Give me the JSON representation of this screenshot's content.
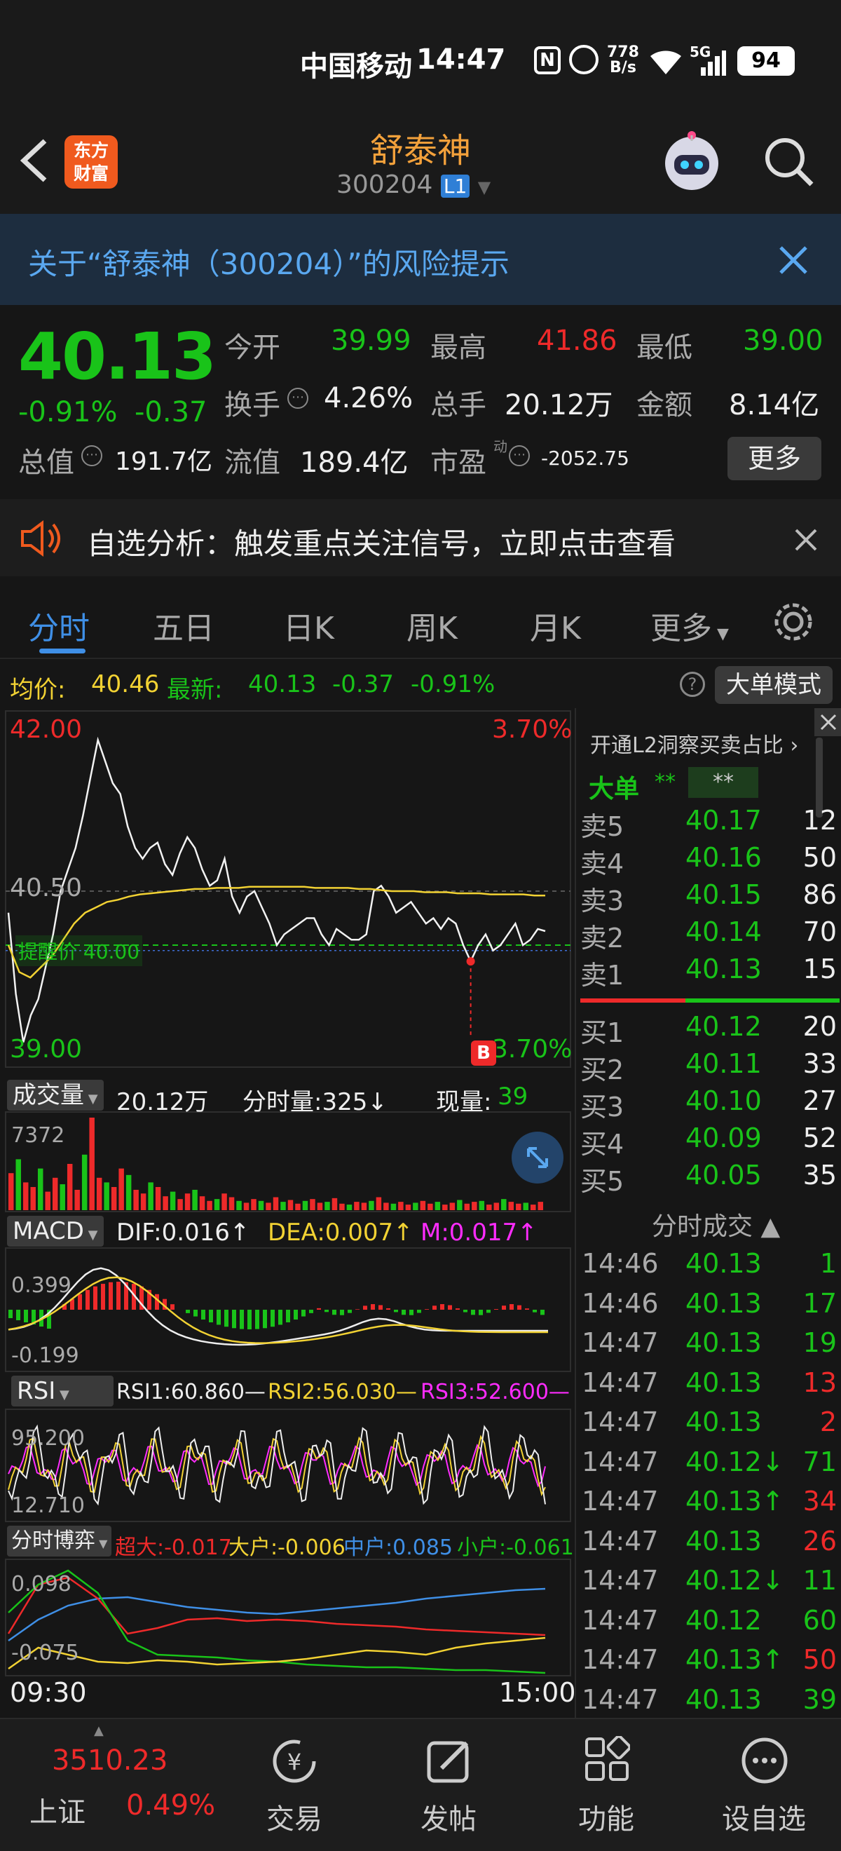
{
  "status_bar": {
    "carrier": "中国移动",
    "time": "14:47",
    "net_speed_value": "778",
    "net_speed_unit": "B/s",
    "signal": "5G",
    "battery": "94"
  },
  "header": {
    "brand": "东方财富",
    "brand_line1": "东方",
    "brand_line2": "财富",
    "title": "舒泰神",
    "code": "300204",
    "level": "L1"
  },
  "risk_banner": {
    "text": "关于“舒泰神（300204）”的风险提示"
  },
  "quote": {
    "price": "40.13",
    "change_pct": "-0.91%",
    "change": "-0.37",
    "open_label": "今开",
    "open": "39.99",
    "high_label": "最高",
    "high": "41.86",
    "low_label": "最低",
    "low": "39.00",
    "turnover_label": "换手",
    "turnover": "4.26%",
    "volume_label": "总手",
    "volume": "20.12万",
    "amount_label": "金额",
    "amount": "8.14亿",
    "mcap_label": "总值",
    "mcap": "191.7亿",
    "float_label": "流值",
    "float": "189.4亿",
    "pe_label": "市盈",
    "pe_sup": "动",
    "pe": "-2052.75",
    "more_label": "更多"
  },
  "notice": {
    "text": "自选分析：触发重点关注信号，立即点击查看"
  },
  "tabs": [
    "分时",
    "五日",
    "日K",
    "周K",
    "月K",
    "更多"
  ],
  "avg_line": {
    "avg_label": "均价:",
    "avg_value": "40.46",
    "latest_label": "最新:",
    "latest_value": "40.13",
    "change": "-0.37",
    "change_pct": "-0.91%",
    "big_order_mode": "大单模式"
  },
  "chart_data": {
    "type": "line",
    "price_axis": {
      "top": "42.00",
      "mid": "40.50",
      "bottom": "39.00",
      "top_pct": "3.70%",
      "bottom_pct": "3.70%",
      "ylim": [
        39.0,
        42.0
      ]
    },
    "alert_price_label": "提醒价 40.00",
    "alert_price": 40.0,
    "buy_marker": "B",
    "price_series": [
      40.3,
      39.55,
      39.1,
      39.35,
      39.5,
      39.8,
      40.1,
      40.5,
      40.7,
      40.9,
      41.2,
      41.55,
      41.9,
      41.7,
      41.5,
      41.4,
      41.1,
      40.9,
      40.8,
      40.9,
      40.95,
      40.75,
      40.65,
      40.85,
      41.0,
      40.9,
      40.7,
      40.55,
      40.6,
      40.8,
      40.45,
      40.3,
      40.45,
      40.5,
      40.35,
      40.2,
      40.0,
      40.1,
      40.15,
      40.2,
      40.25,
      40.25,
      40.1,
      40.0,
      40.15,
      40.1,
      40.05,
      40.05,
      40.1,
      40.5,
      40.55,
      40.45,
      40.3,
      40.35,
      40.4,
      40.3,
      40.2,
      40.25,
      40.15,
      40.25,
      40.2,
      40.0,
      39.85,
      40.0,
      40.1,
      39.95,
      40.0,
      40.1,
      40.2,
      40.0,
      40.05,
      40.15,
      40.13
    ],
    "avg_series": [
      40.0,
      39.75,
      39.7,
      39.8,
      39.9,
      40.05,
      40.2,
      40.3,
      40.35,
      40.4,
      40.42,
      40.45,
      40.47,
      40.48,
      40.49,
      40.5,
      40.51,
      40.52,
      40.52,
      40.53,
      40.53,
      40.53,
      40.54,
      40.54,
      40.54,
      40.54,
      40.54,
      40.54,
      40.53,
      40.53,
      40.53,
      40.53,
      40.52,
      40.52,
      40.51,
      40.5,
      40.5,
      40.5,
      40.49,
      40.49,
      40.49,
      40.48,
      40.48,
      40.48,
      40.47,
      40.47,
      40.47,
      40.47,
      40.46,
      40.46
    ],
    "x_start": "09:30",
    "x_end": "15:00",
    "volume_panel": {
      "label": "成交量",
      "total": "20.12万",
      "tick_label": "分时量:325↓",
      "now_label": "现量:",
      "now_value": "39",
      "max": "7372",
      "bars": [
        40,
        55,
        30,
        25,
        45,
        20,
        35,
        28,
        50,
        22,
        60,
        100,
        35,
        30,
        25,
        45,
        38,
        22,
        18,
        30,
        25,
        15,
        20,
        12,
        18,
        22,
        15,
        10,
        12,
        18,
        14,
        10,
        8,
        12,
        10,
        8,
        14,
        9,
        11,
        7,
        10,
        12,
        8,
        9,
        13,
        7,
        6,
        9,
        8,
        10,
        14,
        8,
        7,
        9,
        6,
        8,
        10,
        7,
        9,
        6,
        8,
        11,
        7,
        9,
        10,
        6,
        8,
        12,
        9,
        7,
        8,
        6,
        9
      ]
    },
    "macd_panel": {
      "label": "MACD",
      "dif": "DIF:0.016↑",
      "dea": "DEA:0.007↑",
      "m": "M:0.017↑",
      "top": "0.399",
      "bottom": "-0.199"
    },
    "rsi_panel": {
      "label": "RSI",
      "rsi1": "RSI1:60.860—",
      "rsi2": "RSI2:56.030—",
      "rsi3": "RSI3:52.600—",
      "top": "95.200",
      "bottom": "12.710"
    },
    "flow_panel": {
      "label": "分时博弈",
      "super": "超大:-0.017",
      "big": "大户:-0.006",
      "mid": "中户:0.085",
      "small": "小户:-0.061",
      "top": "0.098",
      "bottom": "-0.075"
    }
  },
  "order_book": {
    "l2_label": "开通L2洞察买卖占比",
    "big_order_label": "大单",
    "big_order_value1": "**",
    "big_order_value2": "**",
    "asks": [
      {
        "label": "卖5",
        "price": "40.17",
        "vol": "12"
      },
      {
        "label": "卖4",
        "price": "40.16",
        "vol": "50"
      },
      {
        "label": "卖3",
        "price": "40.15",
        "vol": "86"
      },
      {
        "label": "卖2",
        "price": "40.14",
        "vol": "70"
      },
      {
        "label": "卖1",
        "price": "40.13",
        "vol": "15"
      }
    ],
    "bids": [
      {
        "label": "买1",
        "price": "40.12",
        "vol": "20"
      },
      {
        "label": "买2",
        "price": "40.11",
        "vol": "33"
      },
      {
        "label": "买3",
        "price": "40.10",
        "vol": "27"
      },
      {
        "label": "买4",
        "price": "40.09",
        "vol": "52"
      },
      {
        "label": "买5",
        "price": "40.05",
        "vol": "35"
      }
    ],
    "trades_label": "分时成交",
    "trades": [
      {
        "time": "14:46",
        "price": "40.13",
        "vol": "1",
        "color": "#19c319"
      },
      {
        "time": "14:46",
        "price": "40.13",
        "vol": "17",
        "color": "#19c319"
      },
      {
        "time": "14:47",
        "price": "40.13",
        "vol": "19",
        "color": "#19c319"
      },
      {
        "time": "14:47",
        "price": "40.13",
        "vol": "13",
        "color": "#ee2a2a"
      },
      {
        "time": "14:47",
        "price": "40.13",
        "vol": "2",
        "color": "#ee2a2a"
      },
      {
        "time": "14:47",
        "price": "40.12↓",
        "vol": "71",
        "color": "#19c319"
      },
      {
        "time": "14:47",
        "price": "40.13↑",
        "vol": "34",
        "color": "#ee2a2a"
      },
      {
        "time": "14:47",
        "price": "40.13",
        "vol": "26",
        "color": "#ee2a2a"
      },
      {
        "time": "14:47",
        "price": "40.12↓",
        "vol": "11",
        "color": "#19c319"
      },
      {
        "time": "14:47",
        "price": "40.12",
        "vol": "60",
        "color": "#19c319"
      },
      {
        "time": "14:47",
        "price": "40.13↑",
        "vol": "50",
        "color": "#ee2a2a"
      },
      {
        "time": "14:47",
        "price": "40.13",
        "vol": "39",
        "color": "#19c319"
      }
    ]
  },
  "bottom_nav": {
    "index_value": "3510.23",
    "index_name": "上证",
    "index_pct": "0.49%",
    "trade": "交易",
    "post": "发帖",
    "features": "功能",
    "watchlist": "设自选"
  },
  "colors": {
    "up": "#ee2a2a",
    "down": "#19c319",
    "accent": "#3f8fe6",
    "brand": "#f05a1e",
    "title": "#f3a13b"
  }
}
